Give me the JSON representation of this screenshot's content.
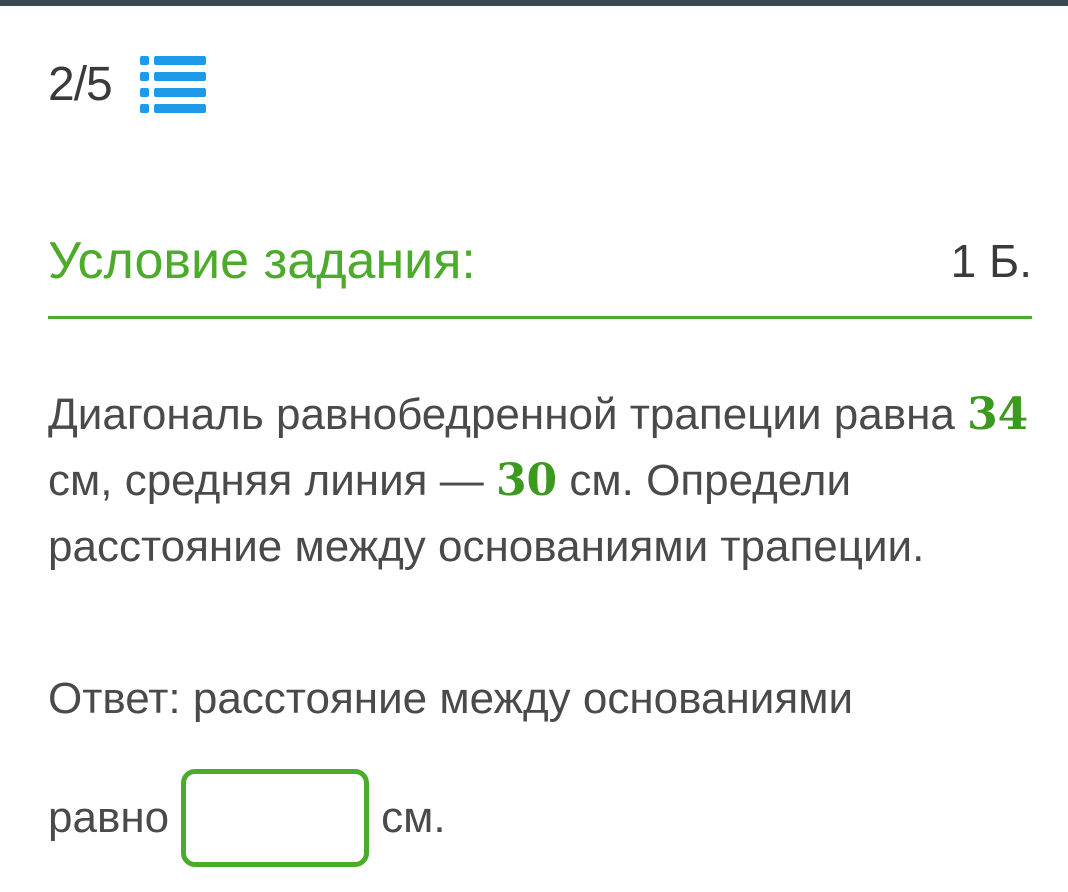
{
  "progress": {
    "text": "2/5"
  },
  "colors": {
    "accent": "#4cab2b",
    "icon": "#1e9be8"
  },
  "icons": {
    "task_list": "list-icon"
  },
  "header": {
    "title": "Условие задания:",
    "points": "1 Б."
  },
  "task": {
    "part1": "Диагональ равнобедренной трапеции равна ",
    "num1": "34",
    "part2": " см, средняя линия — ",
    "num2": "30",
    "part3": " см. Определи расстояние между основаниями трапеции."
  },
  "answer": {
    "line1": "Ответ: расстояние между основаниями",
    "prefix": "равно",
    "value": "",
    "suffix": "см."
  }
}
